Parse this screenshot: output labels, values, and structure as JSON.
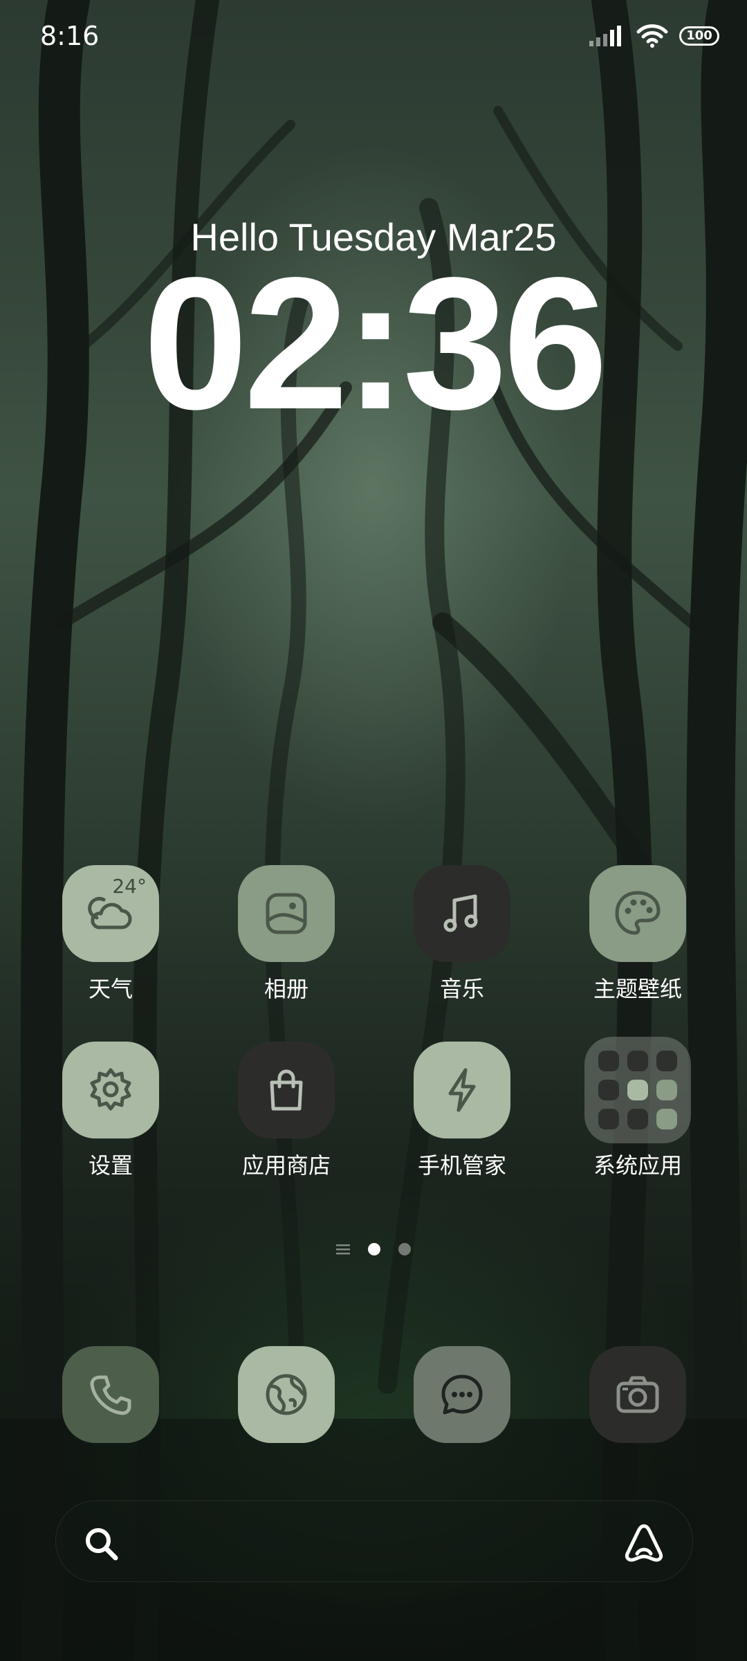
{
  "status_bar": {
    "time": "8:16",
    "battery": "100"
  },
  "lock_widget": {
    "greeting": "Hello Tuesday Mar25",
    "clock": "02:36"
  },
  "apps": [
    {
      "name": "天气",
      "icon": "weather-cloud-icon",
      "badge": "24°"
    },
    {
      "name": "相册",
      "icon": "gallery-icon"
    },
    {
      "name": "音乐",
      "icon": "music-note-icon"
    },
    {
      "name": "主题壁纸",
      "icon": "palette-icon"
    },
    {
      "name": "设置",
      "icon": "gear-icon"
    },
    {
      "name": "应用商店",
      "icon": "shopping-bag-icon"
    },
    {
      "name": "手机管家",
      "icon": "lightning-icon"
    },
    {
      "name": "系统应用",
      "icon": "folder-icon"
    }
  ],
  "page_indicator": {
    "pages": 2,
    "current": 1
  },
  "dock": [
    {
      "icon": "phone-icon"
    },
    {
      "icon": "browser-globe-icon"
    },
    {
      "icon": "message-icon"
    },
    {
      "icon": "camera-icon"
    }
  ],
  "search_bar": {
    "left_icon": "search-icon",
    "right_icon": "assistant-icon"
  },
  "colors": {
    "icon_light": "#a9b9a4",
    "icon_mid": "#8a9b86",
    "icon_dark": "#2c2d2b",
    "glyph_dark": "#4a5649"
  }
}
